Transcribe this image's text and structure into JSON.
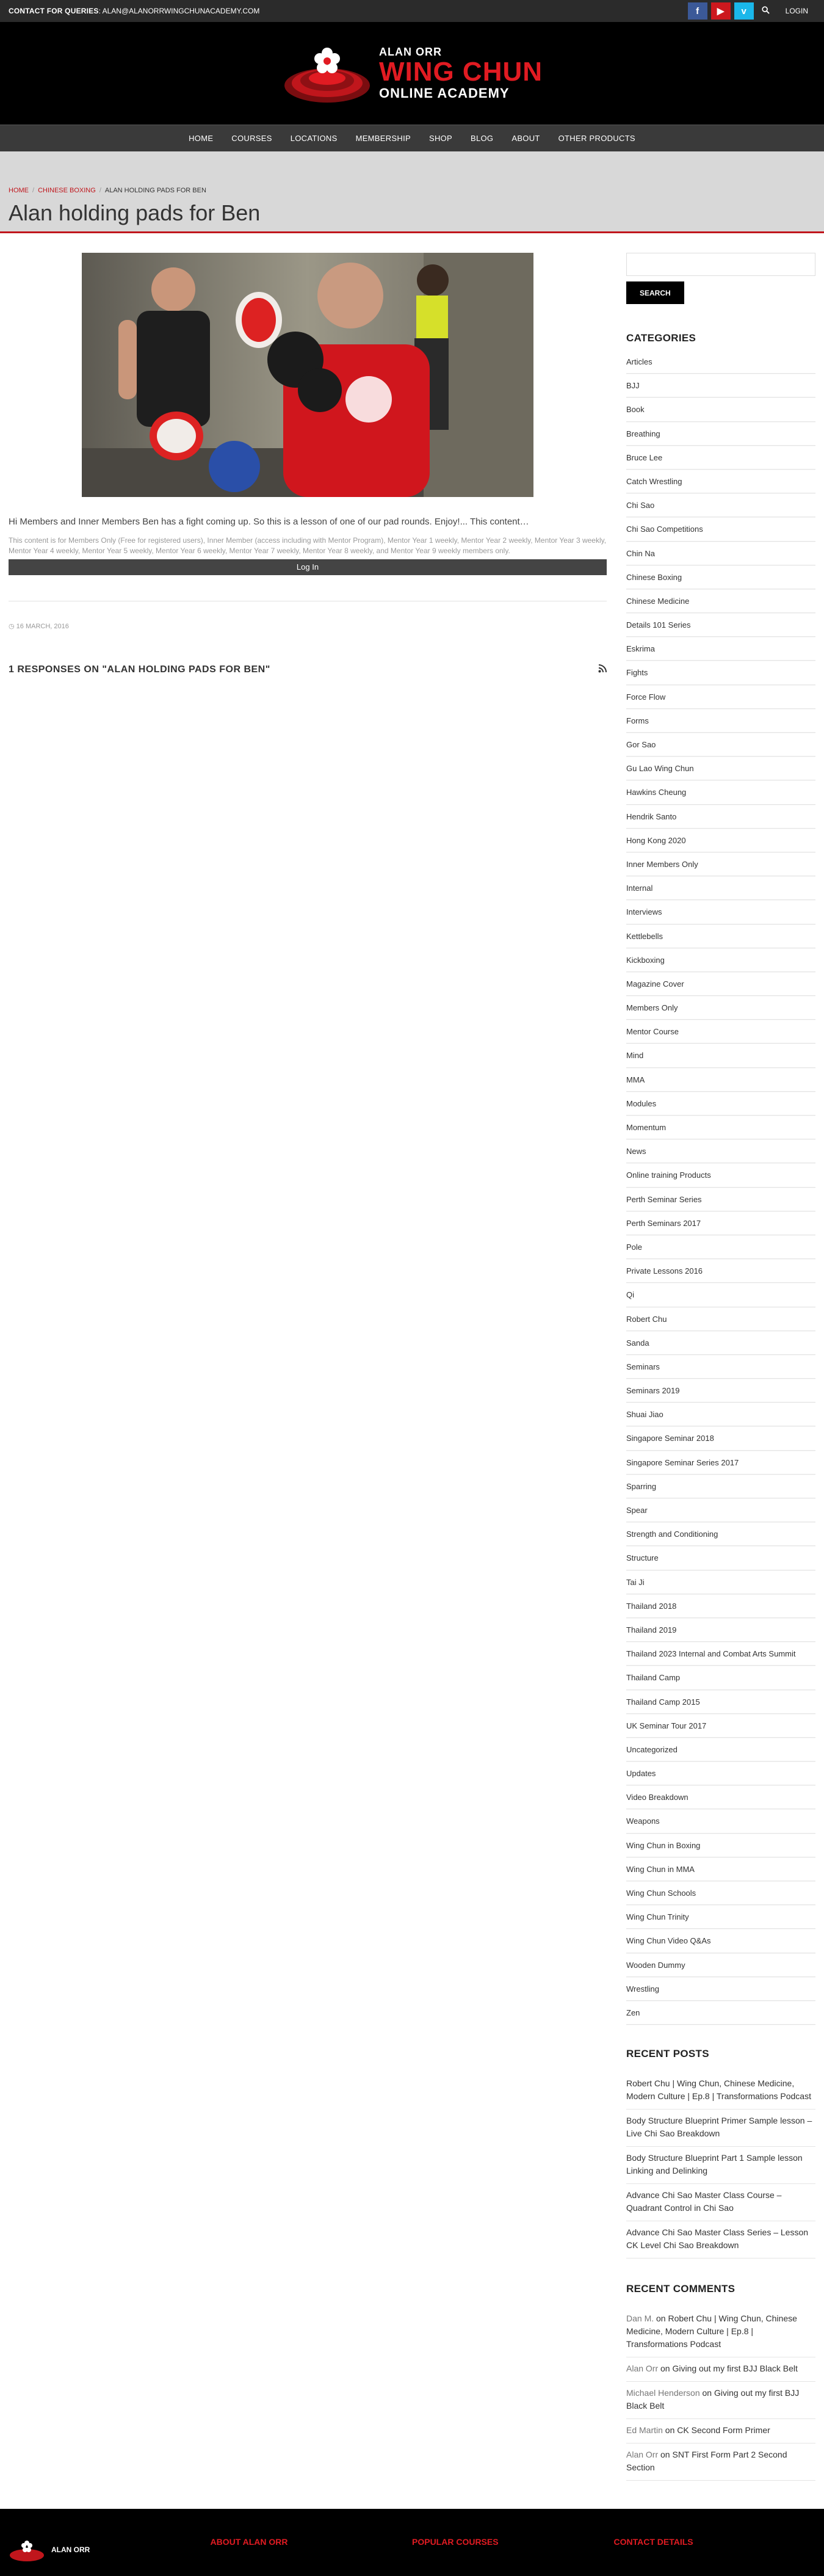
{
  "topbar": {
    "contact_label": "CONTACT FOR QUERIES",
    "contact_email": ": ALAN@ALANORRWINGCHUNACADEMY.COM",
    "social": {
      "facebook": "f",
      "youtube": "▶",
      "vimeo": "v"
    },
    "login": "LOGIN"
  },
  "brand": {
    "line1": "ALAN ORR",
    "line2": "WING CHUN",
    "line3": "ONLINE ACADEMY",
    "accent": "#e11b22"
  },
  "nav": [
    "HOME",
    "COURSES",
    "LOCATIONS",
    "MEMBERSHIP",
    "SHOP",
    "BLOG",
    "ABOUT",
    "OTHER PRODUCTS"
  ],
  "breadcrumb": {
    "home": "HOME",
    "category": "CHINESE BOXING",
    "current": "ALAN HOLDING PADS FOR BEN"
  },
  "page": {
    "title": "Alan holding pads for Ben",
    "excerpt": "Hi Members and Inner Members Ben has a fight coming up. So this is a lesson of one of our pad rounds. Enjoy!... This content…",
    "restriction": "This content is for Members Only (Free for registered users), Inner Member (access including with Mentor Program), Mentor Year 1 weekly, Mentor Year 2 weekly, Mentor Year 3 weekly, Mentor Year 4 weekly, Mentor Year 5 weekly, Mentor Year 6 weekly, Mentor Year 7 weekly, Mentor Year 8 weekly, and Mentor Year 9 weekly members only.",
    "login_button": "Log In",
    "date": "16 MARCH, 2016",
    "responses_title": "1 RESPONSES ON \"ALAN HOLDING PADS FOR BEN\""
  },
  "sidebar": {
    "search_button": "SEARCH",
    "categories_title": "CATEGORIES",
    "categories": [
      "Articles",
      "BJJ",
      "Book",
      "Breathing",
      "Bruce Lee",
      "Catch Wrestling",
      "Chi Sao",
      "Chi Sao Competitions",
      "Chin Na",
      "Chinese Boxing",
      "Chinese Medicine",
      "Details 101 Series",
      "Eskrima",
      "Fights",
      "Force Flow",
      "Forms",
      "Gor Sao",
      "Gu Lao Wing Chun",
      "Hawkins Cheung",
      "Hendrik Santo",
      "Hong Kong 2020",
      "Inner Members Only",
      "Internal",
      "Interviews",
      "Kettlebells",
      "Kickboxing",
      "Magazine Cover",
      "Members Only",
      "Mentor Course",
      "Mind",
      "MMA",
      "Modules",
      "Momentum",
      "News",
      "Online training Products",
      "Perth Seminar Series",
      "Perth Seminars 2017",
      "Pole",
      "Private Lessons 2016",
      "Qi",
      "Robert Chu",
      "Sanda",
      "Seminars",
      "Seminars 2019",
      "Shuai Jiao",
      "Singapore Seminar 2018",
      "Singapore Seminar Series 2017",
      "Sparring",
      "Spear",
      "Strength and Conditioning",
      "Structure",
      "Tai Ji",
      "Thailand 2018",
      "Thailand 2019",
      "Thailand 2023 Internal and Combat Arts Summit",
      "Thailand Camp",
      "Thailand Camp 2015",
      "UK Seminar Tour 2017",
      "Uncategorized",
      "Updates",
      "Video Breakdown",
      "Weapons",
      "Wing Chun in Boxing",
      "Wing Chun in MMA",
      "Wing Chun Schools",
      "Wing Chun Trinity",
      "Wing Chun Video Q&As",
      "Wooden Dummy",
      "Wrestling",
      "Zen"
    ],
    "recent_posts_title": "RECENT POSTS",
    "recent_posts": [
      "Robert Chu | Wing Chun, Chinese Medicine, Modern Culture | Ep.8 | Transformations Podcast",
      "Body Structure Blueprint Primer Sample lesson – Live Chi Sao Breakdown",
      "Body Structure Blueprint Part 1 Sample lesson Linking and Delinking",
      "Advance Chi Sao Master Class Course – Quadrant Control in Chi Sao",
      "Advance Chi Sao Master Class Series – Lesson CK Level Chi Sao Breakdown"
    ],
    "recent_comments_title": "RECENT COMMENTS",
    "recent_comments": [
      {
        "author": "Dan M.",
        "on": " on ",
        "post": "Robert Chu | Wing Chun, Chinese Medicine, Modern Culture | Ep.8 | Transformations Podcast"
      },
      {
        "author": "Alan Orr",
        "on": " on ",
        "post": "Giving out my first BJJ Black Belt"
      },
      {
        "author": "Michael Henderson",
        "on": " on ",
        "post": "Giving out my first BJJ Black Belt"
      },
      {
        "author": "Ed Martin",
        "on": " on ",
        "post": "CK Second Form Primer"
      },
      {
        "author": "Alan Orr",
        "on": " on ",
        "post": "SNT First Form Part 2 Second Section"
      }
    ]
  },
  "footer": {
    "brand": "ALAN ORR",
    "col1": "ABOUT ALAN ORR",
    "col2": "POPULAR COURSES",
    "col3": "CONTACT DETAILS"
  }
}
